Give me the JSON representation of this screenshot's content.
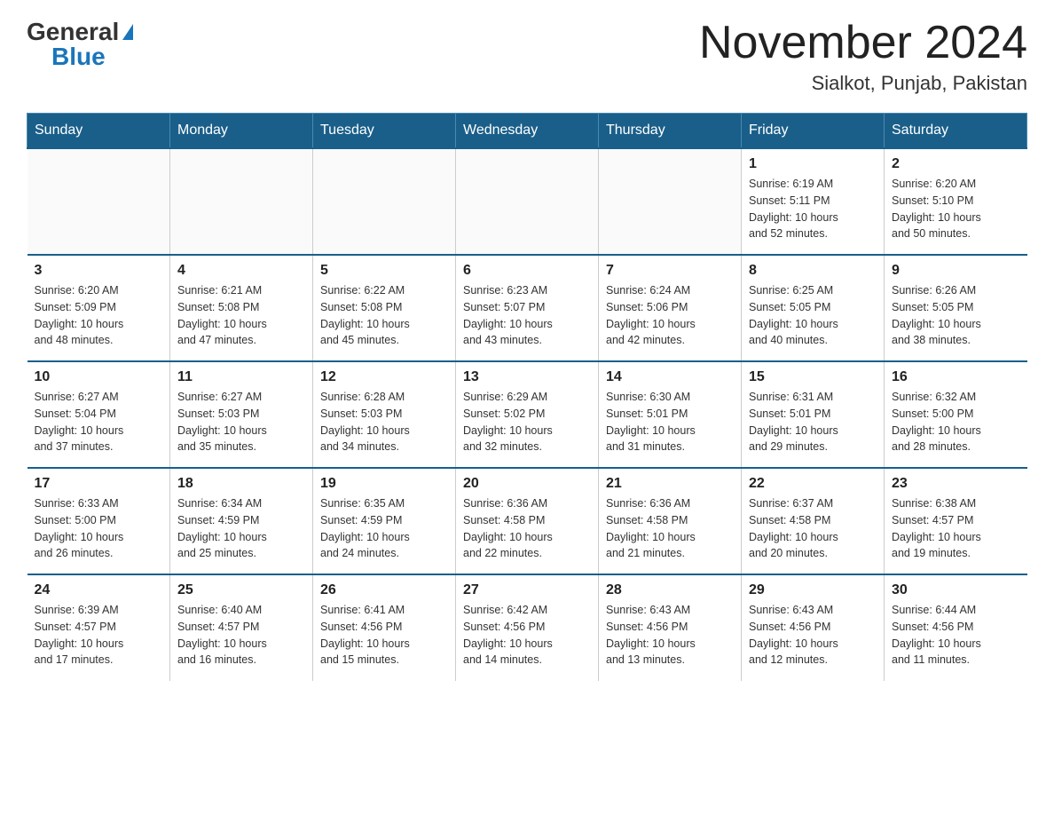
{
  "header": {
    "logo": {
      "general": "General",
      "blue": "Blue"
    },
    "title": "November 2024",
    "subtitle": "Sialkot, Punjab, Pakistan"
  },
  "calendar": {
    "days": [
      "Sunday",
      "Monday",
      "Tuesday",
      "Wednesday",
      "Thursday",
      "Friday",
      "Saturday"
    ],
    "weeks": [
      [
        {
          "day": "",
          "info": ""
        },
        {
          "day": "",
          "info": ""
        },
        {
          "day": "",
          "info": ""
        },
        {
          "day": "",
          "info": ""
        },
        {
          "day": "",
          "info": ""
        },
        {
          "day": "1",
          "info": "Sunrise: 6:19 AM\nSunset: 5:11 PM\nDaylight: 10 hours\nand 52 minutes."
        },
        {
          "day": "2",
          "info": "Sunrise: 6:20 AM\nSunset: 5:10 PM\nDaylight: 10 hours\nand 50 minutes."
        }
      ],
      [
        {
          "day": "3",
          "info": "Sunrise: 6:20 AM\nSunset: 5:09 PM\nDaylight: 10 hours\nand 48 minutes."
        },
        {
          "day": "4",
          "info": "Sunrise: 6:21 AM\nSunset: 5:08 PM\nDaylight: 10 hours\nand 47 minutes."
        },
        {
          "day": "5",
          "info": "Sunrise: 6:22 AM\nSunset: 5:08 PM\nDaylight: 10 hours\nand 45 minutes."
        },
        {
          "day": "6",
          "info": "Sunrise: 6:23 AM\nSunset: 5:07 PM\nDaylight: 10 hours\nand 43 minutes."
        },
        {
          "day": "7",
          "info": "Sunrise: 6:24 AM\nSunset: 5:06 PM\nDaylight: 10 hours\nand 42 minutes."
        },
        {
          "day": "8",
          "info": "Sunrise: 6:25 AM\nSunset: 5:05 PM\nDaylight: 10 hours\nand 40 minutes."
        },
        {
          "day": "9",
          "info": "Sunrise: 6:26 AM\nSunset: 5:05 PM\nDaylight: 10 hours\nand 38 minutes."
        }
      ],
      [
        {
          "day": "10",
          "info": "Sunrise: 6:27 AM\nSunset: 5:04 PM\nDaylight: 10 hours\nand 37 minutes."
        },
        {
          "day": "11",
          "info": "Sunrise: 6:27 AM\nSunset: 5:03 PM\nDaylight: 10 hours\nand 35 minutes."
        },
        {
          "day": "12",
          "info": "Sunrise: 6:28 AM\nSunset: 5:03 PM\nDaylight: 10 hours\nand 34 minutes."
        },
        {
          "day": "13",
          "info": "Sunrise: 6:29 AM\nSunset: 5:02 PM\nDaylight: 10 hours\nand 32 minutes."
        },
        {
          "day": "14",
          "info": "Sunrise: 6:30 AM\nSunset: 5:01 PM\nDaylight: 10 hours\nand 31 minutes."
        },
        {
          "day": "15",
          "info": "Sunrise: 6:31 AM\nSunset: 5:01 PM\nDaylight: 10 hours\nand 29 minutes."
        },
        {
          "day": "16",
          "info": "Sunrise: 6:32 AM\nSunset: 5:00 PM\nDaylight: 10 hours\nand 28 minutes."
        }
      ],
      [
        {
          "day": "17",
          "info": "Sunrise: 6:33 AM\nSunset: 5:00 PM\nDaylight: 10 hours\nand 26 minutes."
        },
        {
          "day": "18",
          "info": "Sunrise: 6:34 AM\nSunset: 4:59 PM\nDaylight: 10 hours\nand 25 minutes."
        },
        {
          "day": "19",
          "info": "Sunrise: 6:35 AM\nSunset: 4:59 PM\nDaylight: 10 hours\nand 24 minutes."
        },
        {
          "day": "20",
          "info": "Sunrise: 6:36 AM\nSunset: 4:58 PM\nDaylight: 10 hours\nand 22 minutes."
        },
        {
          "day": "21",
          "info": "Sunrise: 6:36 AM\nSunset: 4:58 PM\nDaylight: 10 hours\nand 21 minutes."
        },
        {
          "day": "22",
          "info": "Sunrise: 6:37 AM\nSunset: 4:58 PM\nDaylight: 10 hours\nand 20 minutes."
        },
        {
          "day": "23",
          "info": "Sunrise: 6:38 AM\nSunset: 4:57 PM\nDaylight: 10 hours\nand 19 minutes."
        }
      ],
      [
        {
          "day": "24",
          "info": "Sunrise: 6:39 AM\nSunset: 4:57 PM\nDaylight: 10 hours\nand 17 minutes."
        },
        {
          "day": "25",
          "info": "Sunrise: 6:40 AM\nSunset: 4:57 PM\nDaylight: 10 hours\nand 16 minutes."
        },
        {
          "day": "26",
          "info": "Sunrise: 6:41 AM\nSunset: 4:56 PM\nDaylight: 10 hours\nand 15 minutes."
        },
        {
          "day": "27",
          "info": "Sunrise: 6:42 AM\nSunset: 4:56 PM\nDaylight: 10 hours\nand 14 minutes."
        },
        {
          "day": "28",
          "info": "Sunrise: 6:43 AM\nSunset: 4:56 PM\nDaylight: 10 hours\nand 13 minutes."
        },
        {
          "day": "29",
          "info": "Sunrise: 6:43 AM\nSunset: 4:56 PM\nDaylight: 10 hours\nand 12 minutes."
        },
        {
          "day": "30",
          "info": "Sunrise: 6:44 AM\nSunset: 4:56 PM\nDaylight: 10 hours\nand 11 minutes."
        }
      ]
    ]
  }
}
